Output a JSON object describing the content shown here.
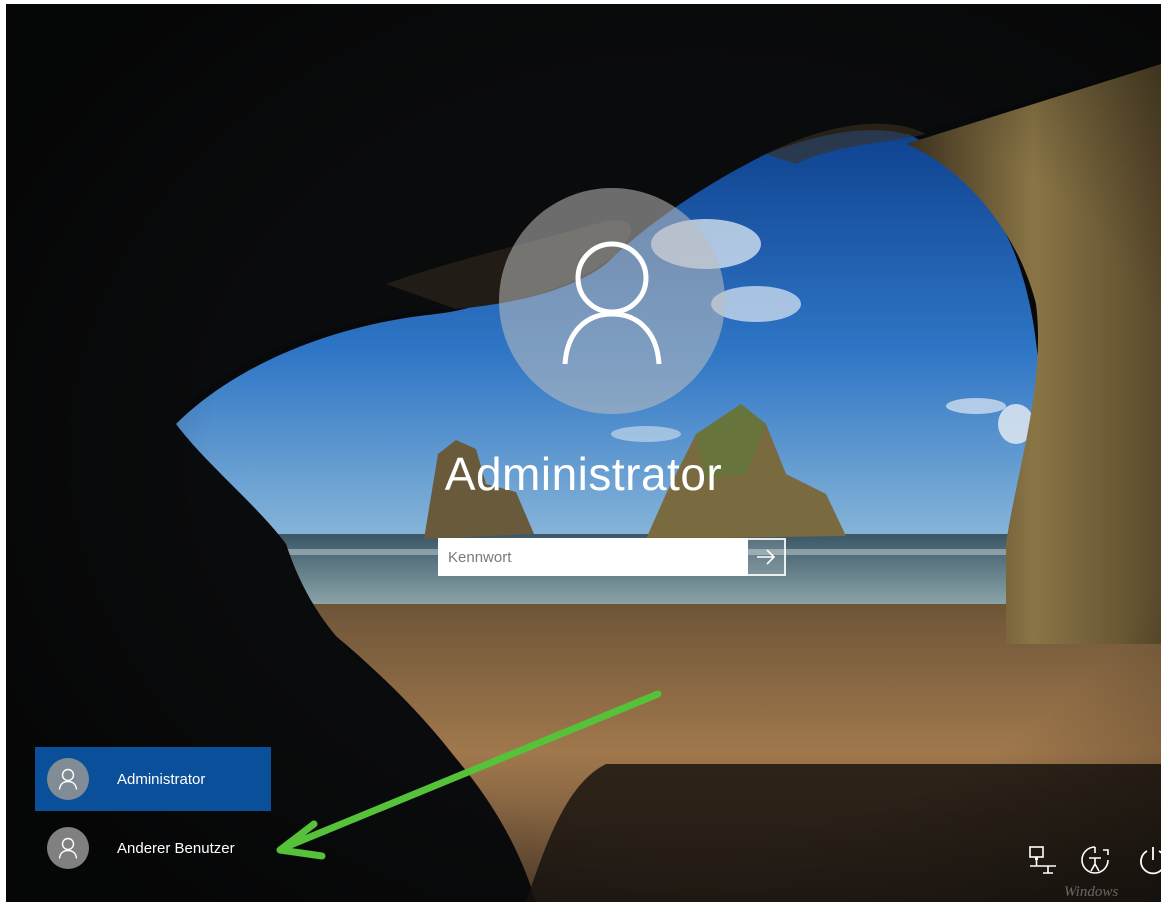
{
  "login": {
    "user_name": "Administrator",
    "password_placeholder": "Kennwort"
  },
  "user_list": [
    {
      "label": "Administrator",
      "selected": true
    },
    {
      "label": "Anderer Benutzer",
      "selected": false
    }
  ],
  "system_icons": [
    "network-icon",
    "ease-of-access-icon",
    "power-icon"
  ],
  "watermark": "Windows",
  "colors": {
    "selected_user_bg": "#0a4f9a",
    "annotation_arrow": "#55c23a"
  }
}
